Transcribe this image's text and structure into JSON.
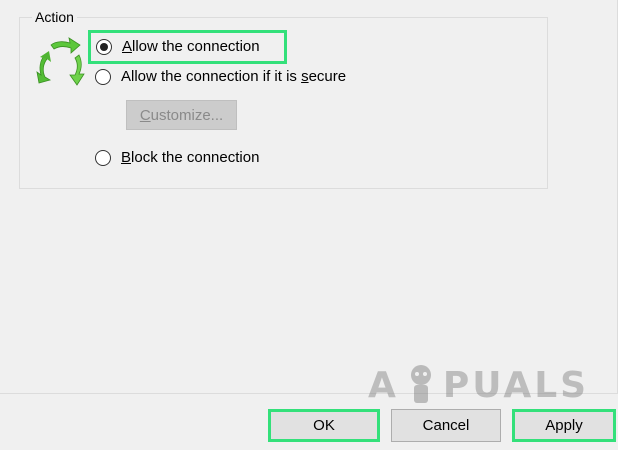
{
  "groupbox": {
    "title": "Action"
  },
  "options": {
    "allow": {
      "label_prefix": "",
      "label_accel": "A",
      "label_suffix": "llow the connection",
      "selected": true
    },
    "secure": {
      "label_prefix": "Allow the connection if it is ",
      "label_accel": "s",
      "label_suffix": "ecure",
      "selected": false
    },
    "block": {
      "label_prefix": "",
      "label_accel": "B",
      "label_suffix": "lock the connection",
      "selected": false
    }
  },
  "customize": {
    "label_prefix": "",
    "label_accel": "C",
    "label_suffix": "ustomize..."
  },
  "footer": {
    "ok_label": "OK",
    "cancel_label": "Cancel",
    "apply_label": "Apply"
  },
  "watermark": {
    "letter_a": "A",
    "rest": "PUALS"
  },
  "colors": {
    "highlight": "#33e07a",
    "panel": "#f0f0f0",
    "icon_green": "#5cc73b"
  },
  "icons": {
    "action": "green-recycle-arrows-icon",
    "watermark_mascot": "appuals-mascot-icon"
  }
}
